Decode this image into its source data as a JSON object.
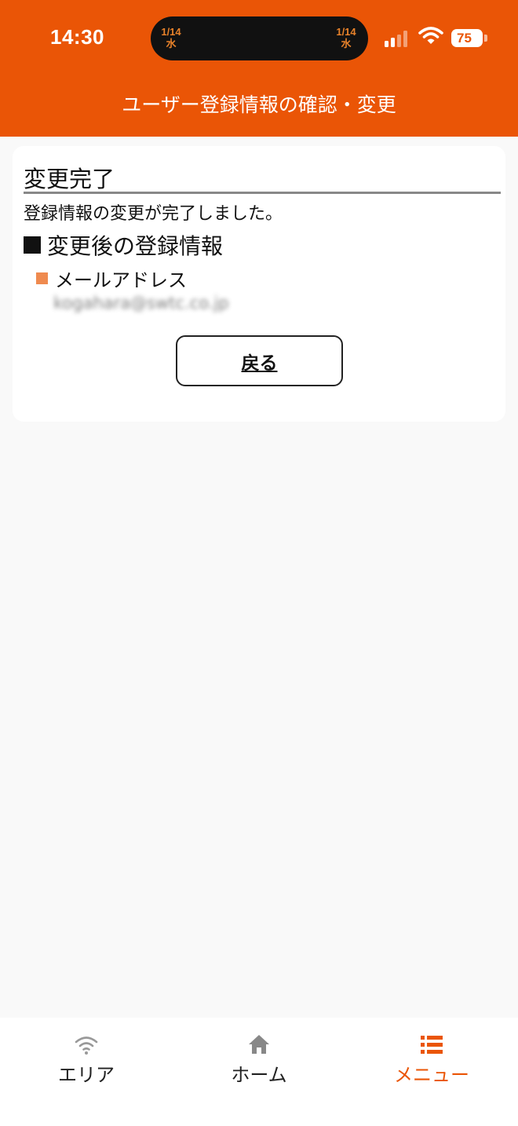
{
  "status_bar": {
    "time": "14:30",
    "island": {
      "left_date": "1/14",
      "left_day": "水",
      "right_date": "1/14",
      "right_day": "水"
    },
    "battery": "75"
  },
  "header": {
    "title": "ユーザー登録情報の確認・変更",
    "background_color": "#ea5506"
  },
  "main": {
    "section_title": "変更完了",
    "message": "登録情報の変更が完了しました。",
    "subheading": "変更後の登録情報",
    "field_label": "メールアドレス",
    "field_value": "kogahara@swtc.co.jp",
    "back_button_label": "戻る"
  },
  "tabbar": {
    "tabs": [
      {
        "label": "エリア",
        "icon": "wifi-icon",
        "active": false
      },
      {
        "label": "ホーム",
        "icon": "home-icon",
        "active": false
      },
      {
        "label": "メニュー",
        "icon": "list-icon",
        "active": true
      }
    ],
    "accent_color": "#ea5506"
  }
}
